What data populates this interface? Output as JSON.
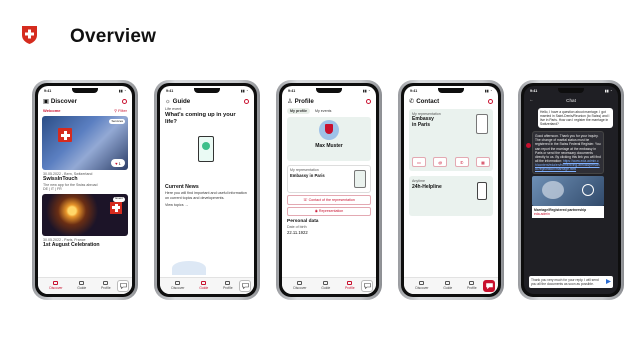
{
  "header": {
    "title": "Overview"
  },
  "discover": {
    "status_time": "9:41",
    "title": "Discover",
    "welcome": "Welcome",
    "filter": "Filter",
    "card1_pill": "Services",
    "card1_likes": "1",
    "card1_meta": "30.05.2022 - Bern, Switzerland",
    "card1_title": "SwissInTouch",
    "card1_sub": "The new app for the Swiss abroad",
    "card1_langs": "DE | IT | FR",
    "card2_pill": "Event",
    "card2_meta": "30.05.2022 - Paris, France",
    "card2_title": "1st August Celebration",
    "tabs": [
      "Discover",
      "Guide",
      "Profile"
    ]
  },
  "guide": {
    "status_time": "9:41",
    "title": "Guide",
    "sub": "Life event",
    "question": "What's coming up in your life?",
    "news_title": "Current News",
    "news_text": "Here you will find important and useful information on current topics and developments.",
    "news_link": "View topics",
    "tabs": [
      "Discover",
      "Guide",
      "Profile"
    ]
  },
  "profile": {
    "status_time": "9:41",
    "title": "Profile",
    "tab_on": "My profile",
    "tab_off": "My events",
    "name": "Max Muster",
    "rep_label": "My representation",
    "rep_value": "Embassy in Paris",
    "btn_contact": "Contact of the representation",
    "btn_rep": "Representation",
    "personal_title": "Personal data",
    "dob_label": "Date of birth",
    "dob_value": "22.11.1922",
    "tabs": [
      "Discover",
      "Guide",
      "Profile"
    ]
  },
  "contact": {
    "status_time": "9:41",
    "title": "Contact",
    "rep_label": "My representation",
    "rep_value_1": "Embassy",
    "rep_value_2": "in Paris",
    "helpline_label": "Anytime",
    "helpline_value": "24h-Helpline",
    "tabs": [
      "Discover",
      "Guide",
      "Profile"
    ]
  },
  "chat": {
    "status_time": "9:41",
    "title": "Chat",
    "msg_out": "Hello, I have a question about marriage. I got married in Saint-Denis/Reunion (to Swiss) and I live in Paris. How can I register the marriage in Switzerland?",
    "msg_in": "Good afternoon. Thank you for your inquiry. The change of marital status must be registered in the Swiss Federal Register. You can report the marriage at the embassy in Paris or send the necessary documents directly to us. By clicking this link you will find all the information:",
    "msg_link": "https://www.eda.admin.ch/content/eda/en/home/living-abroad/personal-registration/marriage.html",
    "card_caption": "Marriage/Registered partnership",
    "card_sub": "eda.admin",
    "input_text": "Thank you very much for your reply. I will send you all the documents as soon as possible."
  },
  "colors": {
    "accent": "#c8102e",
    "mint": "#eaf2ee",
    "chat_bg": "#1f1f24"
  }
}
